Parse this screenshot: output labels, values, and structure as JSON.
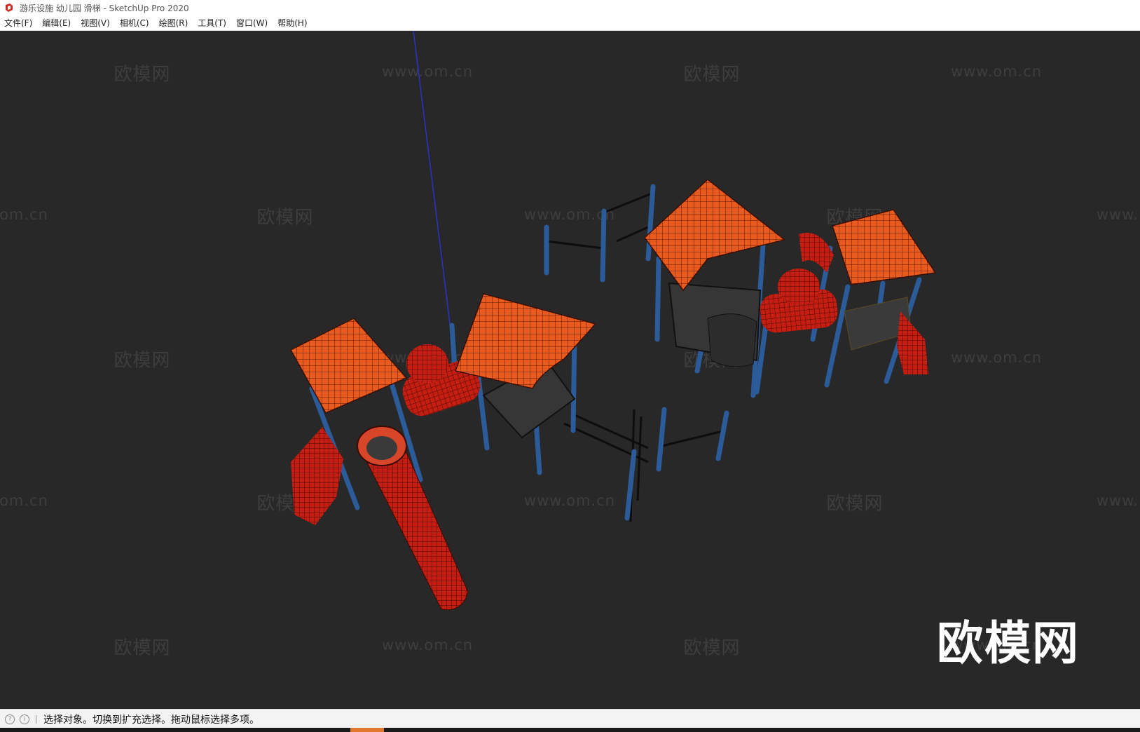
{
  "window": {
    "title": "游乐设施 幼儿园 滑梯 - SketchUp Pro 2020"
  },
  "menu": [
    {
      "label": "文件(F)"
    },
    {
      "label": "编辑(E)"
    },
    {
      "label": "视图(V)"
    },
    {
      "label": "相机(C)"
    },
    {
      "label": "绘图(R)"
    },
    {
      "label": "工具(T)"
    },
    {
      "label": "窗口(W)"
    },
    {
      "label": "帮助(H)"
    }
  ],
  "watermarks": {
    "brand": "欧模网",
    "url": "www.om.cn",
    "partial_url_left": "om.cn",
    "partial_url_right": "www."
  },
  "logo": {
    "text": "欧模网"
  },
  "statusbar": {
    "message": "选择对象。切换到扩充选择。拖动鼠标选择多项。"
  },
  "colors": {
    "viewport_bg": "#282828",
    "roof": "#e85a1e",
    "structure": "#c41e12",
    "posts": "#2c5b9a",
    "axis": "#2a33c8"
  }
}
